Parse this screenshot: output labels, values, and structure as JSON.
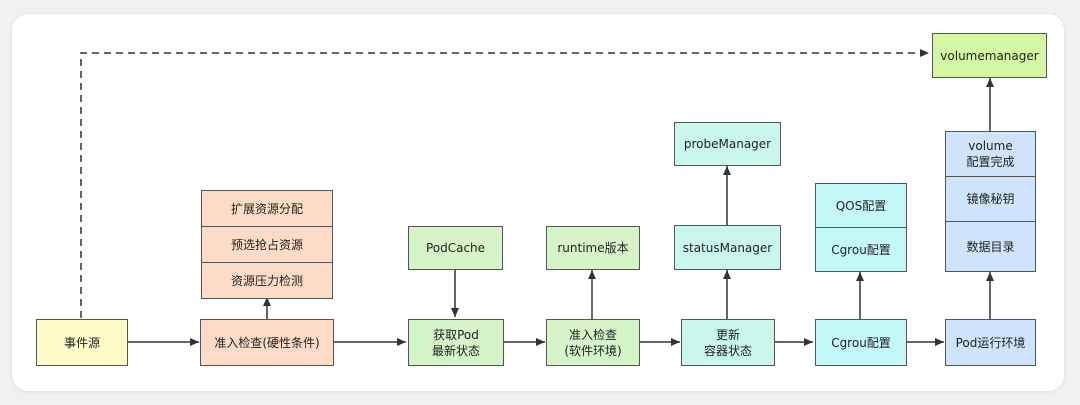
{
  "nodes": {
    "event_source": "事件源",
    "admit_check_hard": "准入检查(硬性条件)",
    "extend_resource_alloc": "扩展资源分配",
    "preempt_resource": "预选抢占资源",
    "resource_pressure_check": "资源压力检测",
    "pod_cache": "PodCache",
    "get_latest_pod_status": "获取Pod\n最新状态",
    "runtime_version": "runtime版本",
    "admit_check_soft": "准入检查\n(软件环境)",
    "probe_manager": "probeManager",
    "status_manager": "statusManager",
    "update_container_status": "更新\n容器状态",
    "qos_config": "QOS配置",
    "cgroup_config_top": "Cgrou配置",
    "cgroup_config": "Cgrou配置",
    "volume_config_done": "volume\n配置完成",
    "image_secret": "镜像秘钥",
    "data_directory": "数据目录",
    "pod_runtime_env": "Pod运行环境",
    "volume_manager": "volumemanager"
  },
  "colors": {
    "yellow": "#fdfbc7",
    "orange": "#fcdcc6",
    "green": "#d5f5c9",
    "teal": "#c9f7ee",
    "cyan": "#c4f7f7",
    "blue": "#cfe3fb",
    "lime": "#d3f7a3",
    "edge": "#333333"
  }
}
